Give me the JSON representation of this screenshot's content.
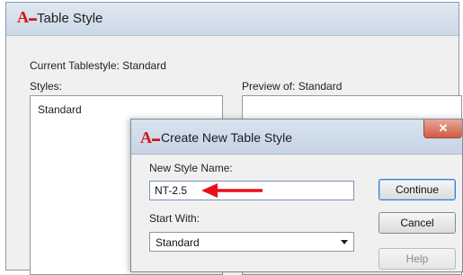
{
  "outer_dialog": {
    "title": "Table Style",
    "icon": "autocad-app-icon",
    "current_tablestyle": "Current Tablestyle: Standard",
    "styles_label": "Styles:",
    "preview_label": "Preview of: Standard",
    "styles_list": [
      "Standard"
    ]
  },
  "inner_dialog": {
    "title": "Create New Table Style",
    "icon": "autocad-app-icon",
    "new_style_name_label": "New Style Name:",
    "new_style_name_value": "NT-2.5",
    "start_with_label": "Start With:",
    "start_with_value": "Standard",
    "buttons": {
      "continue": "Continue",
      "cancel": "Cancel",
      "help": "Help"
    }
  },
  "app_icon_text": "A",
  "close_glyph": "✕",
  "colors": {
    "accent_arrow": "#e8111a",
    "app_icon": "#d3141a",
    "close_button": "#cf5b45",
    "focus_border": "#3a7ad0"
  }
}
